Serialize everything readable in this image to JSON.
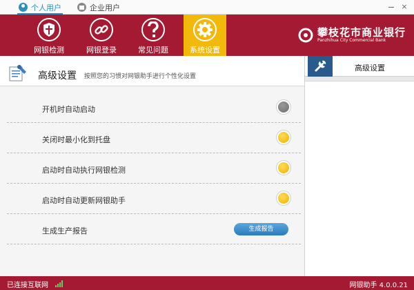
{
  "titlebar": {
    "tabs": [
      {
        "label": "个人用户",
        "active": true
      },
      {
        "label": "企业用户",
        "active": false
      }
    ],
    "minimize_symbol": "–",
    "close_symbol": "×"
  },
  "toolbar": {
    "buttons": [
      {
        "label": "网银检测",
        "icon": "shield-icon"
      },
      {
        "label": "网银登录",
        "icon": "chain-link-icon"
      },
      {
        "label": "常见问题",
        "icon": "question-icon"
      },
      {
        "label": "系统设置",
        "icon": "gear-icon",
        "active": true
      }
    ]
  },
  "logo": {
    "name_cn": "攀枝花市商业银行",
    "name_en": "Panzhihua City Commercial Bank"
  },
  "section": {
    "title": "高级设置",
    "description": "按照您的习惯对网银助手进行个性化设置"
  },
  "settings": [
    {
      "label": "开机时自动启动",
      "state": "off"
    },
    {
      "label": "关闭时最小化到托盘",
      "state": "on"
    },
    {
      "label": "启动时自动执行网银检测",
      "state": "on"
    },
    {
      "label": "启动时自动更新网银助手",
      "state": "on"
    },
    {
      "label": "生成生产报告",
      "button_label": "生成报告"
    }
  ],
  "sidepanel": {
    "tab_label": "高级设置",
    "tab_icon": "wrench-icon"
  },
  "statusbar": {
    "connection": "已连接互联网",
    "version": "网银助手 4.0.0.21"
  },
  "colors": {
    "brand_red": "#a41a32",
    "active_tab": "#f2b90a",
    "toggle_on": "#f0b000",
    "toggle_off": "#7a7a7a",
    "accent_blue": "#2b8fbf"
  }
}
